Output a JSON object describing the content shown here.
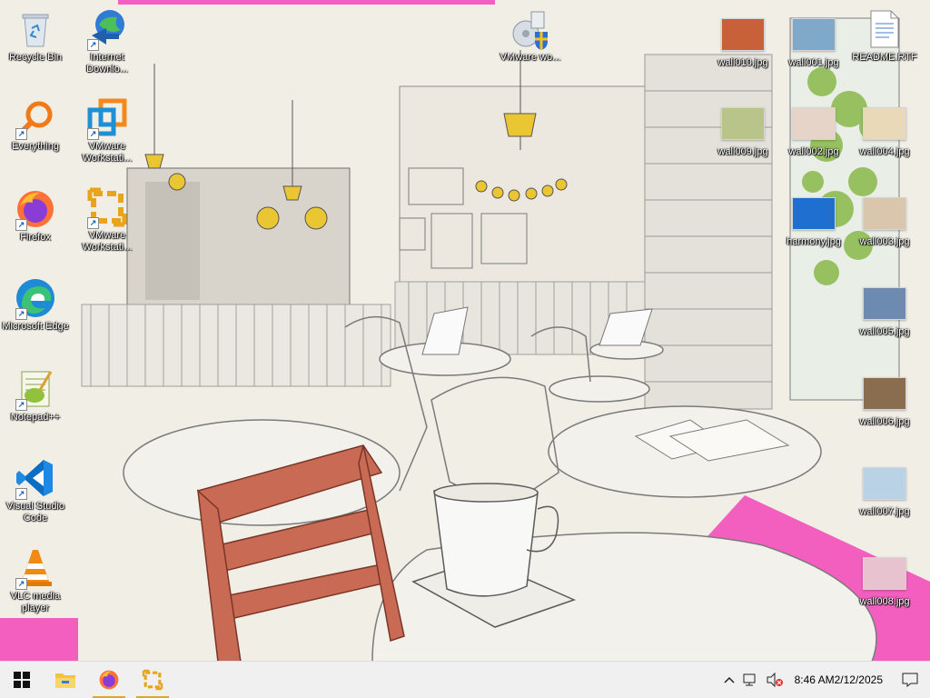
{
  "desktop": {
    "icons_left": [
      {
        "label": "Recycle Bin",
        "icon": "recycle-bin-icon"
      },
      {
        "label": "Everything",
        "icon": "everything-search-icon"
      },
      {
        "label": "Firefox",
        "icon": "firefox-icon"
      },
      {
        "label": "Microsoft Edge",
        "icon": "edge-icon"
      },
      {
        "label": "Notepad++",
        "icon": "notepadpp-icon"
      },
      {
        "label": "Visual Studio Code",
        "icon": "vscode-icon"
      },
      {
        "label": "VLC media player",
        "icon": "vlc-icon"
      }
    ],
    "icons_col2": [
      {
        "label": "Internet Downlo...",
        "icon": "idm-icon"
      },
      {
        "label": "VMware Workstati...",
        "icon": "vmware-workstation-icon"
      },
      {
        "label": "VMware Workstati...",
        "icon": "vmware-workstation-pro-icon"
      }
    ],
    "vmware_top": {
      "label": "VMware wo...",
      "icon": "vmware-installer-icon"
    },
    "files_right": [
      {
        "label": "wall010.jpg",
        "icon": "image-thumbnail-icon",
        "color": "#c8603a"
      },
      {
        "label": "wall001.jpg",
        "icon": "image-thumbnail-icon",
        "color": "#7fa8c9"
      },
      {
        "label": "README.RTF",
        "icon": "rtf-document-icon"
      },
      {
        "label": "wall009.jpg",
        "icon": "image-thumbnail-icon",
        "color": "#b8c48a"
      },
      {
        "label": "wall002.jpg",
        "icon": "image-thumbnail-icon",
        "color": "#e6d4c8"
      },
      {
        "label": "wall004.jpg",
        "icon": "image-thumbnail-icon",
        "color": "#ead9b8"
      },
      {
        "label": "harmony.jpg",
        "icon": "image-thumbnail-icon",
        "color": "#1f6fd1"
      },
      {
        "label": "wall003.jpg",
        "icon": "image-thumbnail-icon",
        "color": "#d9c6ad"
      },
      {
        "label": "wall005.jpg",
        "icon": "image-thumbnail-icon",
        "color": "#6d8bb0"
      },
      {
        "label": "wall006.jpg",
        "icon": "image-thumbnail-icon",
        "color": "#8a6c4e"
      },
      {
        "label": "wall007.jpg",
        "icon": "image-thumbnail-icon",
        "color": "#b9d2e6"
      },
      {
        "label": "wall008.jpg",
        "icon": "image-thumbnail-icon",
        "color": "#e6c3cf"
      }
    ]
  },
  "taskbar": {
    "start": "windows-start-icon",
    "pinned": [
      {
        "name": "file-explorer-icon"
      },
      {
        "name": "firefox-taskbar-icon"
      },
      {
        "name": "vmware-taskbar-icon"
      }
    ],
    "tray": {
      "chevron": "show-hidden-icons-chevron",
      "network": "network-disconnected-icon",
      "volume": "volume-muted-icon",
      "time": "8:46 AM",
      "date": "2/12/2025",
      "notifications": "action-center-icon"
    }
  }
}
